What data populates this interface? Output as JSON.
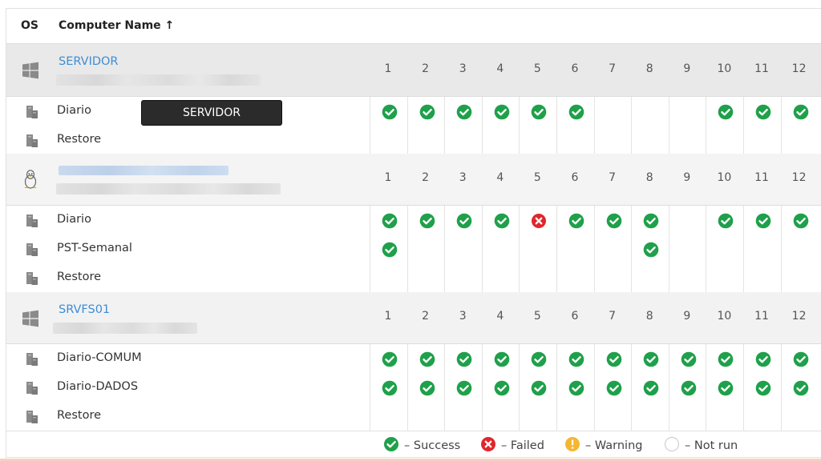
{
  "header": {
    "os_label": "OS",
    "name_label": "Computer Name ↑"
  },
  "days": [
    "1",
    "2",
    "3",
    "4",
    "5",
    "6",
    "7",
    "8",
    "9",
    "10",
    "11",
    "12"
  ],
  "groups": [
    {
      "os": "windows-icon",
      "name": "SERVIDOR",
      "name_blurred": false,
      "jobs": [
        {
          "name": "Diario",
          "statuses": [
            "success",
            "success",
            "success",
            "success",
            "success",
            "success",
            "",
            "",
            "",
            "success",
            "success",
            "success"
          ]
        },
        {
          "name": "Restore",
          "statuses": [
            "",
            "",
            "",
            "",
            "",
            "",
            "",
            "",
            "",
            "",
            "",
            ""
          ]
        }
      ]
    },
    {
      "os": "linux-icon",
      "name": "",
      "name_blurred": true,
      "jobs": [
        {
          "name": "Diario",
          "statuses": [
            "success",
            "success",
            "success",
            "success",
            "failed",
            "success",
            "success",
            "success",
            "",
            "success",
            "success",
            "success"
          ]
        },
        {
          "name": "PST-Semanal",
          "statuses": [
            "success",
            "",
            "",
            "",
            "",
            "",
            "",
            "success",
            "",
            "",
            "",
            ""
          ]
        },
        {
          "name": "Restore",
          "statuses": [
            "",
            "",
            "",
            "",
            "",
            "",
            "",
            "",
            "",
            "",
            "",
            ""
          ]
        }
      ]
    },
    {
      "os": "windows-icon",
      "name": "SRVFS01",
      "name_blurred": false,
      "jobs": [
        {
          "name": "Diario-COMUM",
          "statuses": [
            "success",
            "success",
            "success",
            "success",
            "success",
            "success",
            "success",
            "success",
            "success",
            "success",
            "success",
            "success"
          ]
        },
        {
          "name": "Diario-DADOS",
          "statuses": [
            "success",
            "success",
            "success",
            "success",
            "success",
            "success",
            "success",
            "success",
            "success",
            "success",
            "success",
            "success"
          ]
        },
        {
          "name": "Restore",
          "statuses": [
            "",
            "",
            "",
            "",
            "",
            "",
            "",
            "",
            "",
            "",
            "",
            ""
          ]
        }
      ]
    }
  ],
  "tooltip": {
    "text": "SERVIDOR"
  },
  "legend": {
    "success": "– Success",
    "failed": "– Failed",
    "warning": "– Warning",
    "not_run": "– Not run"
  },
  "colors": {
    "success": "#1fa04a",
    "failed": "#e0262c",
    "warning": "#f5b731",
    "link": "#3c8dd6"
  }
}
